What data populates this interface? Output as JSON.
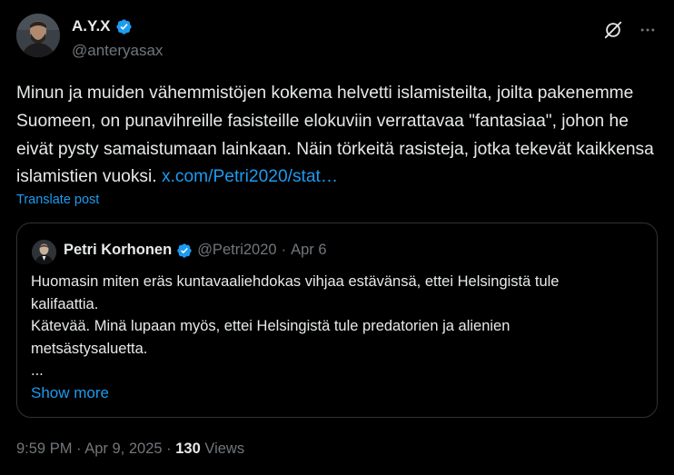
{
  "author": {
    "name": "A.Y.X",
    "handle": "@anteryasax"
  },
  "tweet": {
    "text": "Minun ja muiden vähemmistöjen kokema helvetti islamisteilta, joilta pakenemme Suomeen, on punavihreille fasisteille elokuviin verrattavaa \"fantasiaa\", johon he eivät pysty samaistumaan lainkaan. Näin törkeitä rasisteja, jotka tekevät kaikkensa islamistien vuoksi.",
    "link": "x.com/Petri2020/stat…",
    "translate_label": "Translate post"
  },
  "quote": {
    "name": "Petri Korhonen",
    "handle": "@Petri2020",
    "separator": "·",
    "date": "Apr 6",
    "lines": [
      "Huomasin miten eräs kuntavaaliehdokas vihjaa estävänsä, ettei Helsingistä tule",
      "kalifaattia.",
      "Kätevää. Minä lupaan myös, ettei Helsingistä tule predatorien ja alienien",
      "metsästysaluetta.",
      "..."
    ],
    "show_more_label": "Show more"
  },
  "footer": {
    "time": "9:59 PM",
    "sep1": "·",
    "date": "Apr 9, 2025",
    "sep2": "·",
    "views_count": "130",
    "views_label": "Views"
  },
  "icons": {
    "verified": "verified-badge-icon",
    "grok": "grok-icon",
    "more": "more-horizontal-icon"
  },
  "colors": {
    "background": "#000000",
    "text": "#e7e9ea",
    "secondary": "#71767b",
    "link": "#1d9bf0",
    "border": "#2f3336"
  }
}
